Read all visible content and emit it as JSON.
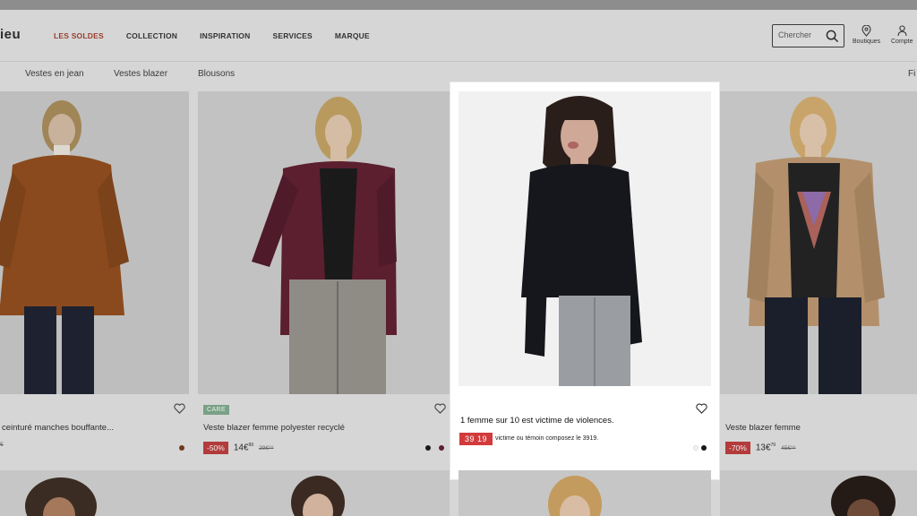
{
  "header": {
    "logo_text": "ieu",
    "nav": [
      {
        "label": "LES SOLDES"
      },
      {
        "label": "COLLECTION"
      },
      {
        "label": "INSPIRATION"
      },
      {
        "label": "SERVICES"
      },
      {
        "label": "MARQUE"
      }
    ],
    "search": {
      "placeholder": "Chercher"
    },
    "stores_label": "Boutiques",
    "account_label": "Compte",
    "accent_color": "#9b3d2c"
  },
  "subnav": {
    "items": [
      {
        "label": "Vestes en jean"
      },
      {
        "label": "Vestes blazer"
      },
      {
        "label": "Blousons"
      }
    ],
    "filter_label": "Fi"
  },
  "products": [
    {
      "title": "ceinturé manches bouffante...",
      "old_price": "̈€",
      "color": "#8a4a1d"
    },
    {
      "title": "Veste blazer femme polyester recyclé",
      "badge": "CARE",
      "discount": "-50%",
      "price": "14€",
      "price_cents": "99",
      "old_price": "29€⁹⁹",
      "color": "#5b1f30"
    },
    {
      "title": "Veste blazer femme",
      "discount": "-70%",
      "price": "13€",
      "price_cents": "79",
      "old_price": "45€⁹⁹",
      "color": "#b3906b"
    }
  ],
  "ad": {
    "title": "1 femme sur 10 est victime de violences.",
    "number": "39 19",
    "text": "victime ou témoin composez le 3919.",
    "number_color": "#d23b3b"
  },
  "icons": {
    "search": "search-icon",
    "stores": "location-pin-icon",
    "account": "user-icon",
    "favorite": "heart-icon"
  }
}
